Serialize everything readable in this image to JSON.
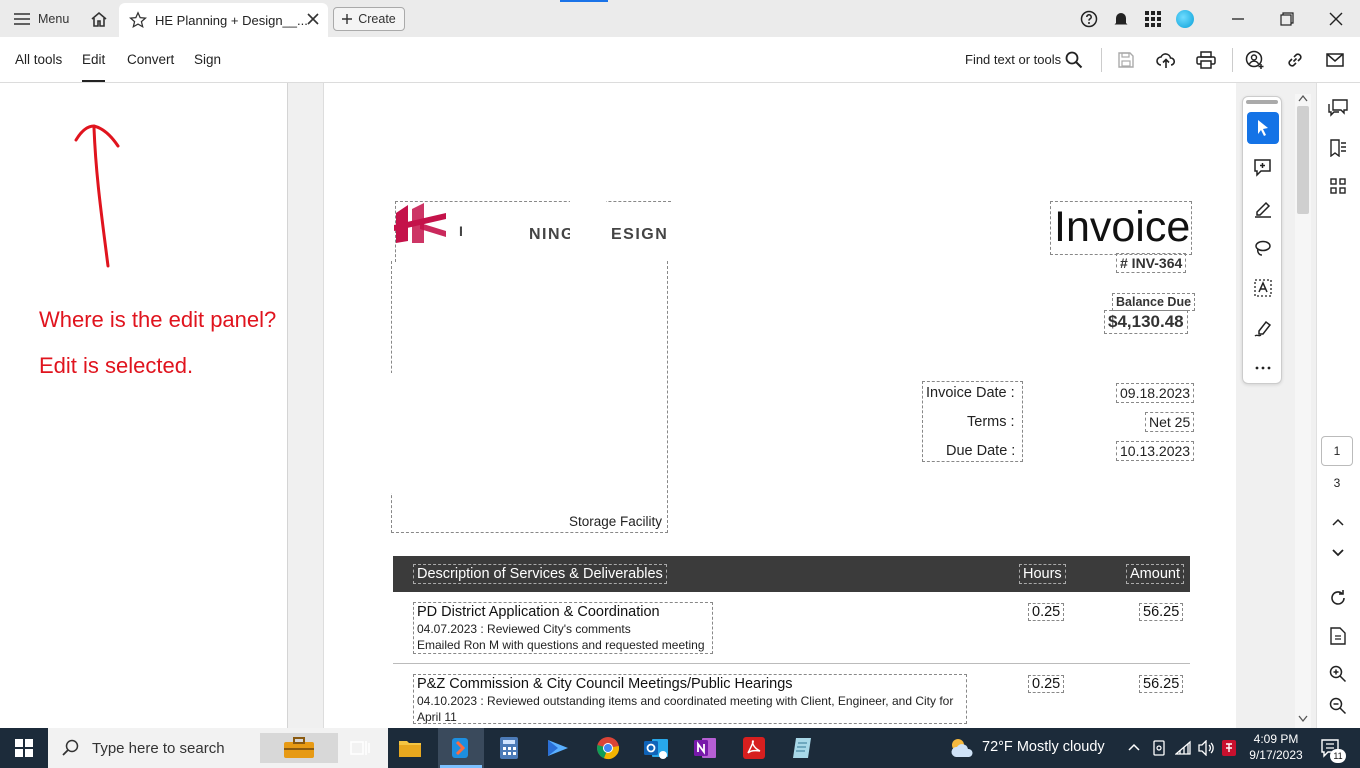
{
  "titlebar": {
    "menu_label": "Menu",
    "tab_title": "HE Planning + Design__...",
    "create_label": "Create"
  },
  "toolbar": {
    "all_tools": "All tools",
    "edit": "Edit",
    "convert": "Convert",
    "sign": "Sign",
    "find_label": "Find text or tools"
  },
  "annotation": {
    "line1": "Where is the edit panel?",
    "line2": "Edit is selected.",
    "color": "#e0141e"
  },
  "document": {
    "logo_text_1": "NING",
    "logo_text_2": "ESIGN",
    "logo_partial": "P",
    "invoice_title": "Invoice",
    "invoice_number": "# INV-364",
    "balance_label": "Balance Due",
    "balance_value": "$4,130.48",
    "meta": [
      {
        "label": "Invoice Date :",
        "value": "09.18.2023"
      },
      {
        "label": "Terms :",
        "value": "Net 25"
      },
      {
        "label": "Due Date :",
        "value": "10.13.2023"
      }
    ],
    "storage_label": "Storage Facility",
    "table": {
      "headers": {
        "description": "Description of Services & Deliverables",
        "hours": "Hours",
        "amount": "Amount"
      },
      "rows": [
        {
          "title": "PD District Application & Coordination",
          "line1": "04.07.2023 : Reviewed City's comments",
          "line2": "Emailed Ron M with questions and requested meeting",
          "hours": "0.25",
          "amount": "56.25"
        },
        {
          "title": "P&Z Commission & City Council Meetings/Public Hearings",
          "line1": "04.10.2023 : Reviewed outstanding items and coordinated meeting with Client, Engineer, and City for",
          "line2": "April 11",
          "hours": "0.25",
          "amount": "56.25"
        }
      ]
    }
  },
  "sidebar": {
    "current_page": "1",
    "total_pages": "3"
  },
  "taskbar": {
    "search_placeholder": "Type here to search",
    "weather": "72°F  Mostly cloudy",
    "time": "4:09 PM",
    "date": "9/17/2023",
    "notification_count": "11"
  },
  "colors": {
    "accent": "#1a73e8",
    "logo": "#c4124a",
    "table_header": "#3b3b3b",
    "taskbar": "#1c2b3a"
  }
}
